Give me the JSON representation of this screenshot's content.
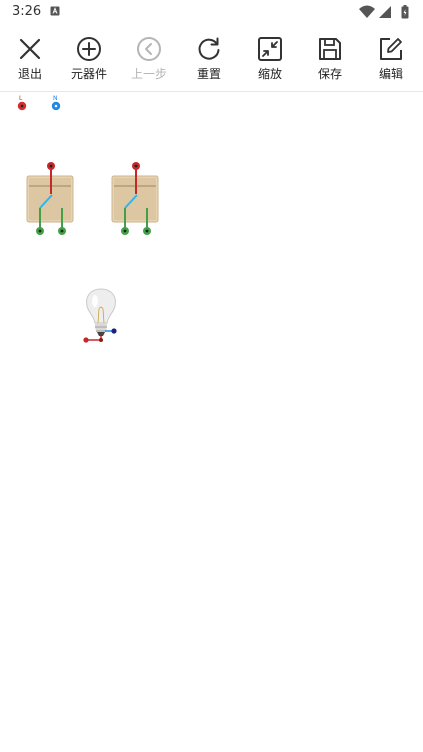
{
  "status_bar": {
    "time": "3:26",
    "icons": [
      "a-notification-icon",
      "wifi-icon",
      "signal-icon",
      "battery-icon"
    ]
  },
  "toolbar": {
    "items": [
      {
        "label": "退出",
        "icon": "close-icon",
        "enabled": true
      },
      {
        "label": "元器件",
        "icon": "add-circle-icon",
        "enabled": true
      },
      {
        "label": "上一步",
        "icon": "back-circle-icon",
        "enabled": false
      },
      {
        "label": "重置",
        "icon": "refresh-icon",
        "enabled": true
      },
      {
        "label": "缩放",
        "icon": "shrink-icon",
        "enabled": true
      },
      {
        "label": "保存",
        "icon": "save-icon",
        "enabled": true
      },
      {
        "label": "编辑",
        "icon": "edit-icon",
        "enabled": true
      }
    ]
  },
  "canvas": {
    "terminals": [
      {
        "label": "L",
        "color": "#d32f2f"
      },
      {
        "label": "N",
        "color": "#1e88e5"
      }
    ],
    "components": [
      {
        "type": "switch",
        "icon": "switch-icon"
      },
      {
        "type": "switch",
        "icon": "switch-icon"
      },
      {
        "type": "bulb",
        "icon": "light-bulb-icon"
      }
    ]
  }
}
